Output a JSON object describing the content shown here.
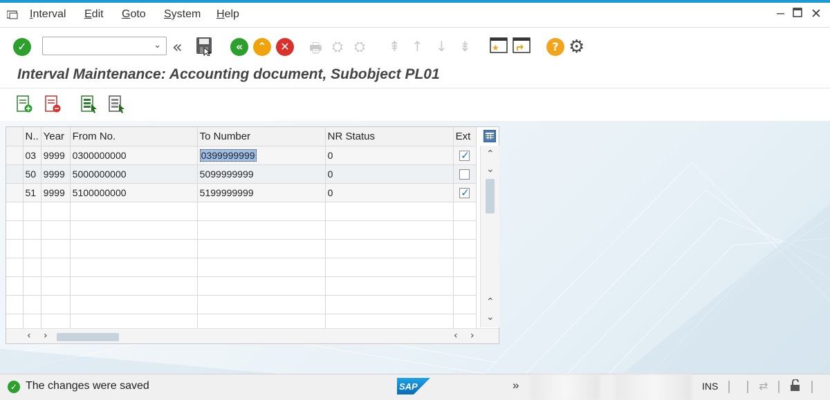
{
  "menu": {
    "items": [
      "Interval",
      "Edit",
      "Goto",
      "System",
      "Help"
    ]
  },
  "toolbar": {
    "command_value": "",
    "icons": [
      "enter-icon",
      "back-icon",
      "save-icon",
      "back-green-icon",
      "exit-icon",
      "cancel-icon",
      "print-icon",
      "find-icon",
      "find-next-icon",
      "first-page-icon",
      "previous-page-icon",
      "next-page-icon",
      "last-page-icon",
      "new-session-icon",
      "shortcut-icon",
      "help-icon",
      "settings-icon"
    ]
  },
  "page": {
    "title": "Interval Maintenance: Accounting document, Subobject PL01"
  },
  "table": {
    "columns": [
      "N..",
      "Year",
      "From No.",
      "To Number",
      "NR Status",
      "Ext"
    ],
    "rows": [
      {
        "n": "03",
        "year": "9999",
        "from": "0300000000",
        "to": "0399999999",
        "status": "0",
        "ext": true
      },
      {
        "n": "50",
        "year": "9999",
        "from": "5000000000",
        "to": "5099999999",
        "status": "0",
        "ext": false
      },
      {
        "n": "51",
        "year": "9999",
        "from": "5100000000",
        "to": "5199999999",
        "status": "0",
        "ext": true
      }
    ],
    "empty_rows": 7
  },
  "status": {
    "message": "The changes were saved",
    "mode": "INS",
    "logo": "SAP",
    "nav": "»"
  },
  "colors": {
    "accent": "#1a9ad6",
    "ok_green": "#2c9f2c",
    "cancel_red": "#d9312b",
    "exit_orange": "#f0a30a",
    "help_orange": "#f2a41c"
  }
}
